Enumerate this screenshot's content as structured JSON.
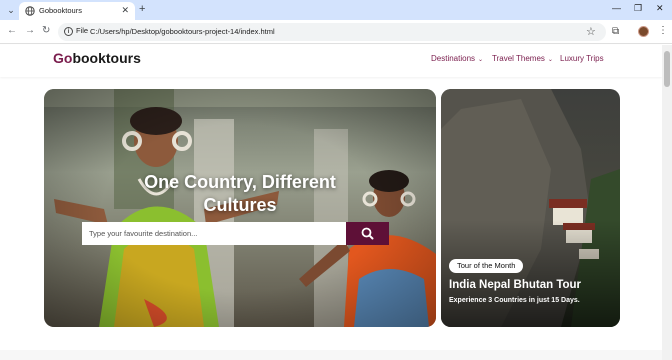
{
  "browser": {
    "tab_title": "Gobooktours",
    "new_tab": "+",
    "close_tab": "✕",
    "chip": "File",
    "url": "C:/Users/hp/Desktop/gobooktours-project-14/index.html",
    "win_min": "—",
    "win_restore": "❐",
    "win_close": "✕"
  },
  "site": {
    "logo_first": "Go",
    "logo_rest": "booktours",
    "nav": [
      {
        "label": "Destinations",
        "has_dropdown": true
      },
      {
        "label": "Travel Themes",
        "has_dropdown": true
      },
      {
        "label": "Luxury Trips",
        "has_dropdown": false
      }
    ]
  },
  "hero": {
    "title_line1": "One Country, Different",
    "title_line2": "Cultures",
    "search_placeholder": "Type your favourite destination...",
    "search_button_icon": "search-icon"
  },
  "feature": {
    "badge": "Tour of the Month",
    "title": "India Nepal Bhutan Tour",
    "subtitle": "Experience 3 Countries in just 15 Days."
  },
  "colors": {
    "brand": "#7a1d4d",
    "search_button": "#5e1037",
    "chrome_tab_bar": "#d3e3fd"
  }
}
